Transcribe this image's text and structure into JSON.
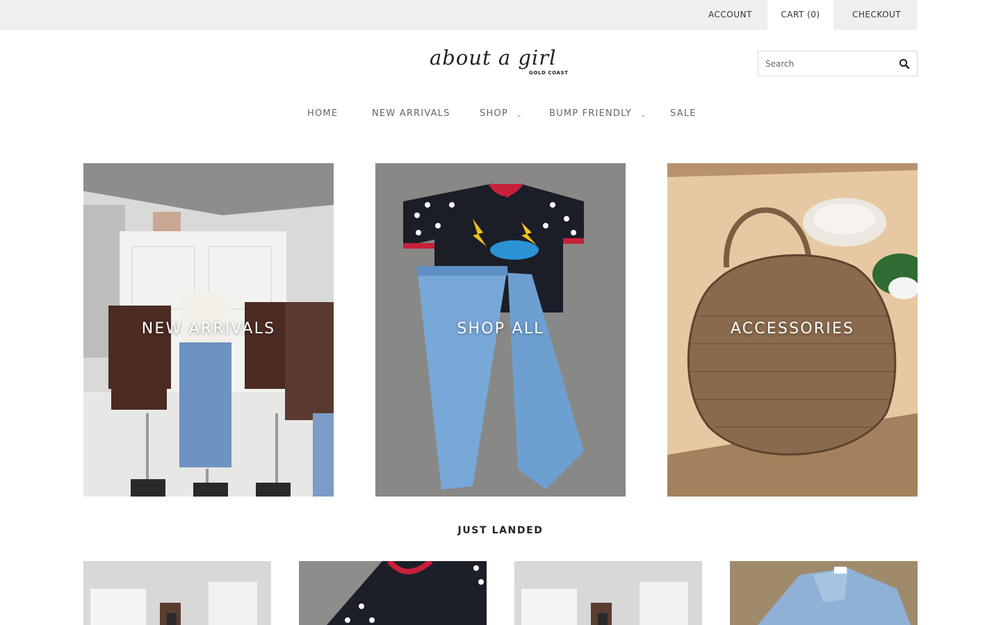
{
  "topbar": {
    "account": "ACCOUNT",
    "cart": "CART (0)",
    "checkout": "CHECKOUT"
  },
  "logo": {
    "script": "about a girl",
    "sub": "GOLD COAST"
  },
  "search": {
    "placeholder": "Search",
    "value": "",
    "icon": "search-icon"
  },
  "nav": {
    "home": "HOME",
    "new_arrivals": "NEW ARRIVALS",
    "shop": "SHOP",
    "bump_friendly": "BUMP FRIENDLY",
    "sale": "SALE",
    "dropdown_icon": "chevron-down-icon"
  },
  "tiles": [
    {
      "label": "NEW ARRIVALS"
    },
    {
      "label": "SHOP ALL"
    },
    {
      "label": "ACCESSORIES"
    }
  ],
  "just_landed": {
    "title": "JUST LANDED"
  },
  "colors": {
    "topbar_bg": "#efefef",
    "nav_text": "#666666",
    "tile_label": "#ffffff"
  }
}
